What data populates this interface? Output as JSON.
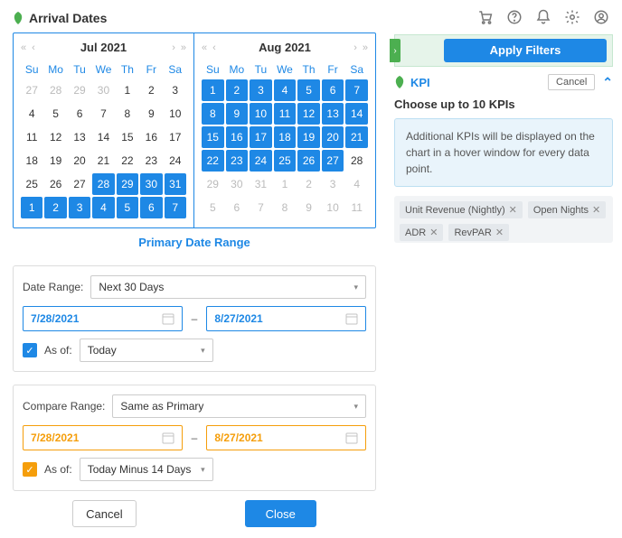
{
  "title": "Arrival Dates",
  "calendars": [
    {
      "title": "Jul 2021",
      "weekdays": [
        "Su",
        "Mo",
        "Tu",
        "We",
        "Th",
        "Fr",
        "Sa"
      ],
      "days": [
        {
          "d": 27,
          "s": "muted"
        },
        {
          "d": 28,
          "s": "muted"
        },
        {
          "d": 29,
          "s": "muted"
        },
        {
          "d": 30,
          "s": "muted"
        },
        {
          "d": 1,
          "s": "norm"
        },
        {
          "d": 2,
          "s": "norm"
        },
        {
          "d": 3,
          "s": "norm"
        },
        {
          "d": 4,
          "s": "norm"
        },
        {
          "d": 5,
          "s": "norm"
        },
        {
          "d": 6,
          "s": "norm"
        },
        {
          "d": 7,
          "s": "norm"
        },
        {
          "d": 8,
          "s": "norm"
        },
        {
          "d": 9,
          "s": "norm"
        },
        {
          "d": 10,
          "s": "norm"
        },
        {
          "d": 11,
          "s": "norm"
        },
        {
          "d": 12,
          "s": "norm"
        },
        {
          "d": 13,
          "s": "norm"
        },
        {
          "d": 14,
          "s": "norm"
        },
        {
          "d": 15,
          "s": "norm"
        },
        {
          "d": 16,
          "s": "norm"
        },
        {
          "d": 17,
          "s": "norm"
        },
        {
          "d": 18,
          "s": "norm"
        },
        {
          "d": 19,
          "s": "norm"
        },
        {
          "d": 20,
          "s": "norm"
        },
        {
          "d": 21,
          "s": "norm"
        },
        {
          "d": 22,
          "s": "norm"
        },
        {
          "d": 23,
          "s": "norm"
        },
        {
          "d": 24,
          "s": "norm"
        },
        {
          "d": 25,
          "s": "norm"
        },
        {
          "d": 26,
          "s": "norm"
        },
        {
          "d": 27,
          "s": "norm"
        },
        {
          "d": 28,
          "s": "sel"
        },
        {
          "d": 29,
          "s": "sel"
        },
        {
          "d": 30,
          "s": "sel"
        },
        {
          "d": 31,
          "s": "sel"
        },
        {
          "d": 1,
          "s": "sel"
        },
        {
          "d": 2,
          "s": "sel"
        },
        {
          "d": 3,
          "s": "sel"
        },
        {
          "d": 4,
          "s": "sel"
        },
        {
          "d": 5,
          "s": "sel"
        },
        {
          "d": 6,
          "s": "sel"
        },
        {
          "d": 7,
          "s": "sel"
        }
      ]
    },
    {
      "title": "Aug 2021",
      "weekdays": [
        "Su",
        "Mo",
        "Tu",
        "We",
        "Th",
        "Fr",
        "Sa"
      ],
      "days": [
        {
          "d": 1,
          "s": "sel"
        },
        {
          "d": 2,
          "s": "sel"
        },
        {
          "d": 3,
          "s": "sel"
        },
        {
          "d": 4,
          "s": "sel"
        },
        {
          "d": 5,
          "s": "sel"
        },
        {
          "d": 6,
          "s": "sel"
        },
        {
          "d": 7,
          "s": "sel"
        },
        {
          "d": 8,
          "s": "sel"
        },
        {
          "d": 9,
          "s": "sel"
        },
        {
          "d": 10,
          "s": "sel"
        },
        {
          "d": 11,
          "s": "sel"
        },
        {
          "d": 12,
          "s": "sel"
        },
        {
          "d": 13,
          "s": "sel"
        },
        {
          "d": 14,
          "s": "sel"
        },
        {
          "d": 15,
          "s": "sel"
        },
        {
          "d": 16,
          "s": "sel"
        },
        {
          "d": 17,
          "s": "sel"
        },
        {
          "d": 18,
          "s": "sel"
        },
        {
          "d": 19,
          "s": "sel"
        },
        {
          "d": 20,
          "s": "sel"
        },
        {
          "d": 21,
          "s": "sel"
        },
        {
          "d": 22,
          "s": "sel"
        },
        {
          "d": 23,
          "s": "sel"
        },
        {
          "d": 24,
          "s": "sel"
        },
        {
          "d": 25,
          "s": "sel"
        },
        {
          "d": 26,
          "s": "sel"
        },
        {
          "d": 27,
          "s": "sel"
        },
        {
          "d": 28,
          "s": "norm"
        },
        {
          "d": 29,
          "s": "muted"
        },
        {
          "d": 30,
          "s": "muted"
        },
        {
          "d": 31,
          "s": "muted"
        },
        {
          "d": 1,
          "s": "muted"
        },
        {
          "d": 2,
          "s": "muted"
        },
        {
          "d": 3,
          "s": "muted"
        },
        {
          "d": 4,
          "s": "muted"
        },
        {
          "d": 5,
          "s": "muted"
        },
        {
          "d": 6,
          "s": "muted"
        },
        {
          "d": 7,
          "s": "muted"
        },
        {
          "d": 8,
          "s": "muted"
        },
        {
          "d": 9,
          "s": "muted"
        },
        {
          "d": 10,
          "s": "muted"
        },
        {
          "d": 11,
          "s": "muted"
        }
      ]
    }
  ],
  "primary_label": "Primary Date Range",
  "date_panel": {
    "range_label": "Date Range:",
    "range_value": "Next 30 Days",
    "start": "7/28/2021",
    "end": "8/27/2021",
    "asof_label": "As of:",
    "asof_value": "Today"
  },
  "compare_panel": {
    "range_label": "Compare Range:",
    "range_value": "Same as Primary",
    "start": "7/28/2021",
    "end": "8/27/2021",
    "asof_label": "As of:",
    "asof_value": "Today Minus 14 Days"
  },
  "buttons": {
    "cancel": "Cancel",
    "close": "Close"
  },
  "right": {
    "apply": "Apply Filters",
    "kpi_title": "KPI",
    "cancel": "Cancel",
    "choose_label": "Choose up to 10 KPIs",
    "info": "Additional KPIs will be displayed on the chart in a hover window for every data point.",
    "tags": [
      "Unit Revenue (Nightly)",
      "Open Nights",
      "ADR",
      "RevPAR"
    ]
  }
}
